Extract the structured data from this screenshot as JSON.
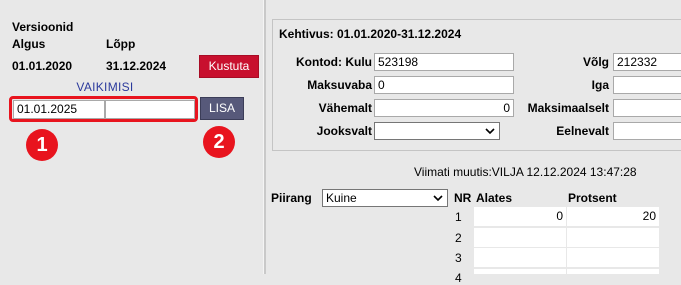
{
  "versions": {
    "title": "Versioonid",
    "col_start": "Algus",
    "col_end": "Lõpp",
    "row": {
      "start": "01.01.2020",
      "end": "31.12.2024"
    },
    "delete_label": "Kustuta",
    "default_label": "VAIKIMISI",
    "new_start_value": "01.01.2025",
    "new_end_value": "",
    "add_label": "LISA",
    "badge1": "1",
    "badge2": "2"
  },
  "detail": {
    "validity": "Kehtivus: 01.01.2020-31.12.2024",
    "accounts_label": "Kontod: Kulu",
    "accounts_value": "523198",
    "debt_label": "Võlg",
    "debt_value": "212332",
    "payment_label": "Maksuvaba",
    "payment_value": "0",
    "each_label": "Iga",
    "each_value": "",
    "min_label": "Vähemalt",
    "min_value": "0",
    "max_label": "Maksimaalselt",
    "max_value": "",
    "current_label": "Jooksvalt",
    "current_value": "",
    "previous_label": "Eelnevalt",
    "previous_value": "",
    "last_modified": "Viimati muutis:VILJA 12.12.2024 13:47:28"
  },
  "limit": {
    "label": "Piirang",
    "selected": "Kuine",
    "table": {
      "headers": [
        "NR",
        "Alates",
        "Protsent"
      ],
      "rows": [
        {
          "nr": "1",
          "from": "0",
          "percent": "20"
        },
        {
          "nr": "2",
          "from": "",
          "percent": ""
        },
        {
          "nr": "3",
          "from": "",
          "percent": ""
        },
        {
          "nr": "4",
          "from": "",
          "percent": ""
        }
      ]
    }
  }
}
